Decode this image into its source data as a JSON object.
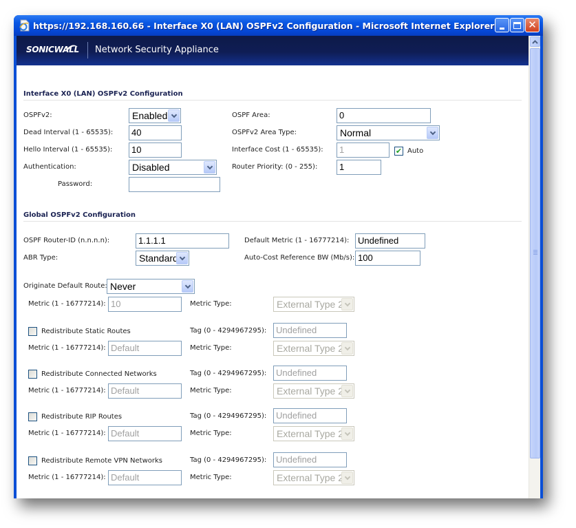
{
  "window": {
    "title": "https://192.168.160.66 - Interface X0 (LAN) OSPFv2 Configuration - Microsoft Internet Explorer",
    "controls": [
      "minimize",
      "maximize",
      "close"
    ]
  },
  "banner": {
    "logo": "SONICWALL",
    "title": "Network Security Appliance"
  },
  "interface_section": {
    "title": "Interface X0 (LAN) OSPFv2 Configuration",
    "ospfv2": {
      "label": "OSPFv2:",
      "value": "Enabled"
    },
    "dead_interval": {
      "label": "Dead Interval (1 - 65535):",
      "value": "40"
    },
    "hello_interval": {
      "label": "Hello Interval (1 - 65535):",
      "value": "10"
    },
    "authentication": {
      "label": "Authentication:",
      "value": "Disabled"
    },
    "password": {
      "label": "Password:",
      "value": ""
    },
    "ospf_area": {
      "label": "OSPF Area:",
      "value": "0"
    },
    "area_type": {
      "label": "OSPFv2 Area Type:",
      "value": "Normal"
    },
    "interface_cost": {
      "label": "Interface Cost (1 - 65535):",
      "value": "1",
      "auto_label": "Auto",
      "auto_checked": true
    },
    "router_priority": {
      "label": "Router Priority: (0 - 255):",
      "value": "1"
    }
  },
  "global_section": {
    "title": "Global OSPFv2 Configuration",
    "router_id": {
      "label": "OSPF Router-ID (n.n.n.n):",
      "value": "1.1.1.1"
    },
    "abr_type": {
      "label": "ABR Type:",
      "value": "Standard"
    },
    "default_metric": {
      "label": "Default Metric (1 - 16777214):",
      "value": "Undefined"
    },
    "auto_cost_bw": {
      "label": "Auto-Cost Reference BW (Mb/s):",
      "value": "100"
    },
    "originate_default_route": {
      "label": "Originate Default Route:",
      "value": "Never",
      "metric_label": "Metric (1 - 16777214):",
      "metric_value": "10",
      "metric_type_label": "Metric Type:",
      "metric_type_value": "External Type 2"
    },
    "redistribute": [
      {
        "label": "Redistribute Static Routes",
        "checked": false,
        "tag_label": "Tag (0 - 4294967295):",
        "tag_value": "Undefined",
        "metric_label": "Metric (1 - 16777214):",
        "metric_value": "Default",
        "metric_type_label": "Metric Type:",
        "metric_type_value": "External Type 2"
      },
      {
        "label": "Redistribute Connected Networks",
        "checked": false,
        "tag_label": "Tag (0 - 4294967295):",
        "tag_value": "Undefined",
        "metric_label": "Metric (1 - 16777214):",
        "metric_value": "Default",
        "metric_type_label": "Metric Type:",
        "metric_type_value": "External Type 2"
      },
      {
        "label": "Redistribute RIP Routes",
        "checked": false,
        "tag_label": "Tag (0 - 4294967295):",
        "tag_value": "Undefined",
        "metric_label": "Metric (1 - 16777214):",
        "metric_value": "Default",
        "metric_type_label": "Metric Type:",
        "metric_type_value": "External Type 2"
      },
      {
        "label": "Redistribute Remote VPN Networks",
        "checked": false,
        "tag_label": "Tag (0 - 4294967295):",
        "tag_value": "Undefined",
        "metric_label": "Metric (1 - 16777214):",
        "metric_value": "Default",
        "metric_type_label": "Metric Type:",
        "metric_type_value": "External Type 2"
      }
    ]
  },
  "icons": {
    "app": "ie-page-icon",
    "scroll_up": "chevron-up-icon",
    "dropdown": "chevron-down-icon",
    "checkmark": "check-icon"
  }
}
